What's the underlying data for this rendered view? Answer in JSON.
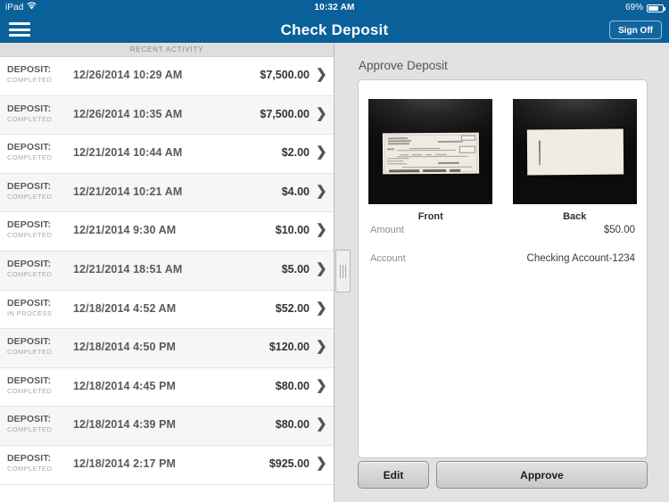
{
  "status_bar": {
    "device": "iPad",
    "wifi_icon": "wifi-icon",
    "time": "10:32 AM",
    "battery_percent": "69%",
    "battery_icon": "battery-icon"
  },
  "navbar": {
    "menu_icon": "hamburger-menu-icon",
    "title": "Check Deposit",
    "sign_off_label": "Sign Off"
  },
  "master": {
    "section_header": "RECENT ACTIVITY",
    "chevron_icon": "chevron-right-icon",
    "rows": [
      {
        "type": "DEPOSIT:",
        "status": "COMPLETED",
        "date": "12/26/2014 10:29 AM",
        "amount": "$7,500.00"
      },
      {
        "type": "DEPOSIT:",
        "status": "COMPLETED",
        "date": "12/26/2014 10:35 AM",
        "amount": "$7,500.00"
      },
      {
        "type": "DEPOSIT:",
        "status": "COMPLETED",
        "date": "12/21/2014 10:44 AM",
        "amount": "$2.00"
      },
      {
        "type": "DEPOSIT:",
        "status": "COMPLETED",
        "date": "12/21/2014 10:21 AM",
        "amount": "$4.00"
      },
      {
        "type": "DEPOSIT:",
        "status": "COMPLETED",
        "date": "12/21/2014 9:30 AM",
        "amount": "$10.00"
      },
      {
        "type": "DEPOSIT:",
        "status": "COMPLETED",
        "date": "12/21/2014 18:51 AM",
        "amount": "$5.00"
      },
      {
        "type": "DEPOSIT:",
        "status": "IN PROCESS",
        "date": "12/18/2014 4:52 AM",
        "amount": "$52.00"
      },
      {
        "type": "DEPOSIT:",
        "status": "COMPLETED",
        "date": "12/18/2014 4:50 PM",
        "amount": "$120.00"
      },
      {
        "type": "DEPOSIT:",
        "status": "COMPLETED",
        "date": "12/18/2014 4:45 PM",
        "amount": "$80.00"
      },
      {
        "type": "DEPOSIT:",
        "status": "COMPLETED",
        "date": "12/18/2014 4:39 PM",
        "amount": "$80.00"
      },
      {
        "type": "DEPOSIT:",
        "status": "COMPLETED",
        "date": "12/18/2014 2:17 PM",
        "amount": "$925.00"
      }
    ]
  },
  "divider": {
    "handle_icon": "split-view-drag-handle-icon"
  },
  "detail": {
    "title": "Approve Deposit",
    "check_front": {
      "image_name": "check-front-photo",
      "caption": "Front"
    },
    "check_back": {
      "image_name": "check-back-photo",
      "caption": "Back"
    },
    "fields": [
      {
        "label": "Amount",
        "value": "$50.00"
      },
      {
        "label": "Account",
        "value": "Checking Account-1234"
      }
    ],
    "buttons": {
      "edit_label": "Edit",
      "approve_label": "Approve"
    }
  },
  "colors": {
    "nav_blue": "#0a6099",
    "panel_gray": "#e2e2e2",
    "row_alt": "#f6f6f6",
    "status_muted": "#a9a9a9"
  }
}
